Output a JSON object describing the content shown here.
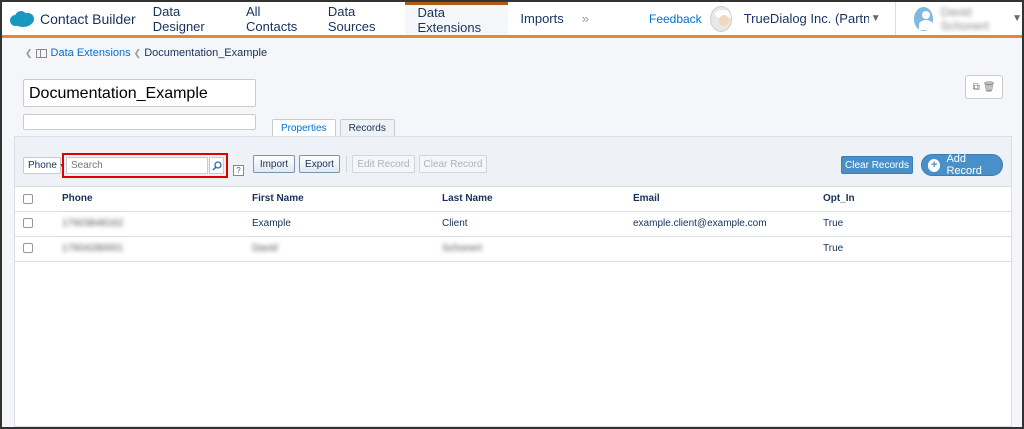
{
  "nav": {
    "app_name": "Contact Builder",
    "tabs": [
      "Data Designer",
      "All Contacts",
      "Data Sources",
      "Data Extensions",
      "Imports"
    ],
    "active_tab": "Data Extensions",
    "more": "»",
    "feedback": "Feedback",
    "org": "TrueDialog Inc. (Partner…",
    "user": "David Schonert"
  },
  "breadcrumb": {
    "parent": "Data Extensions",
    "current": "Documentation_Example"
  },
  "record": {
    "name": "Documentation_Example",
    "description": ""
  },
  "tabs": [
    "Properties",
    "Records"
  ],
  "toolbar": {
    "field": "Phone",
    "search_placeholder": "Search",
    "help": "?",
    "import": "Import",
    "export": "Export",
    "edit_record": "Edit Record",
    "clear_record": "Clear Record",
    "clear_records": "Clear Records",
    "add_record": "Add Record"
  },
  "table": {
    "columns": [
      "Phone",
      "First Name",
      "Last Name",
      "Email",
      "Opt_In"
    ],
    "rows": [
      [
        "17603848162",
        "Example",
        "Client",
        "example.client@example.com",
        "True"
      ],
      [
        "17604280001",
        "David",
        "Schonert",
        "",
        "True"
      ]
    ]
  },
  "colors": {
    "accent": "#e28a32",
    "primary_button": "#4a90c8",
    "highlight": "#e00000"
  }
}
